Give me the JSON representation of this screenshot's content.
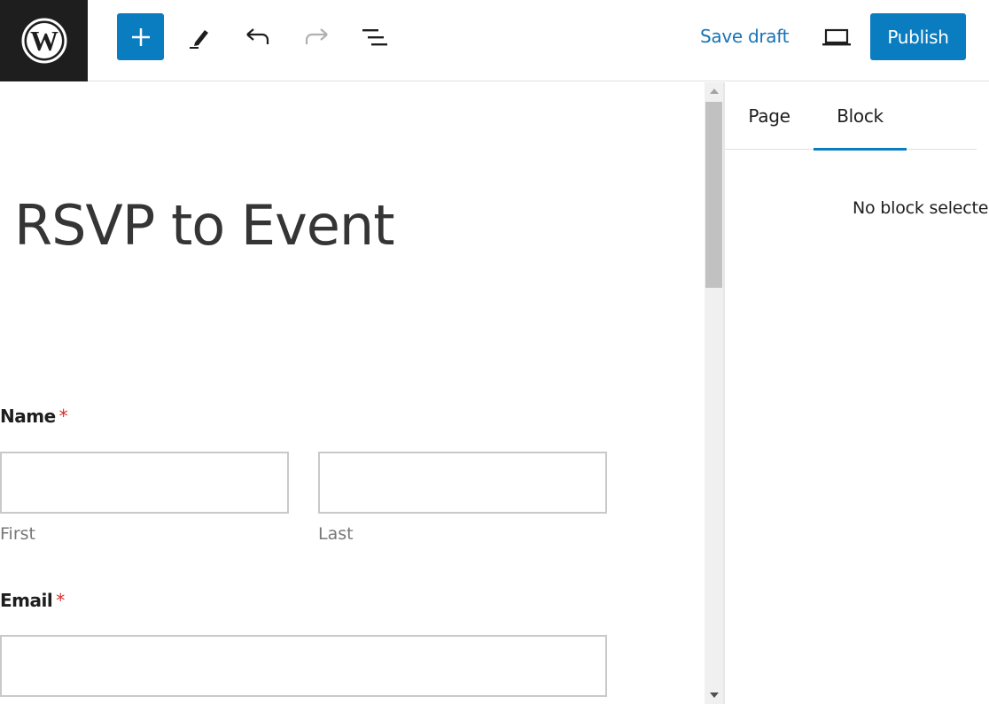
{
  "toolbar": {
    "logo_icon": "wordpress-logo-icon",
    "inserter_icon": "plus-icon",
    "tools_icon": "pencil-icon",
    "undo_icon": "undo-icon",
    "redo_icon": "redo-icon",
    "outline_icon": "list-view-icon",
    "save_draft_label": "Save draft",
    "preview_icon": "laptop-icon",
    "publish_label": "Publish",
    "accent_color": "#0a7cc0"
  },
  "editor": {
    "title": "RSVP to Event",
    "form": {
      "name_label": "Name",
      "name_required": "*",
      "first_sublabel": "First",
      "last_sublabel": "Last",
      "first_value": "",
      "last_value": "",
      "email_label": "Email",
      "email_required": "*",
      "email_value": ""
    }
  },
  "sidebar": {
    "tabs": [
      {
        "label": "Page",
        "active": false
      },
      {
        "label": "Block",
        "active": true
      }
    ],
    "empty_message": "No block selected."
  }
}
